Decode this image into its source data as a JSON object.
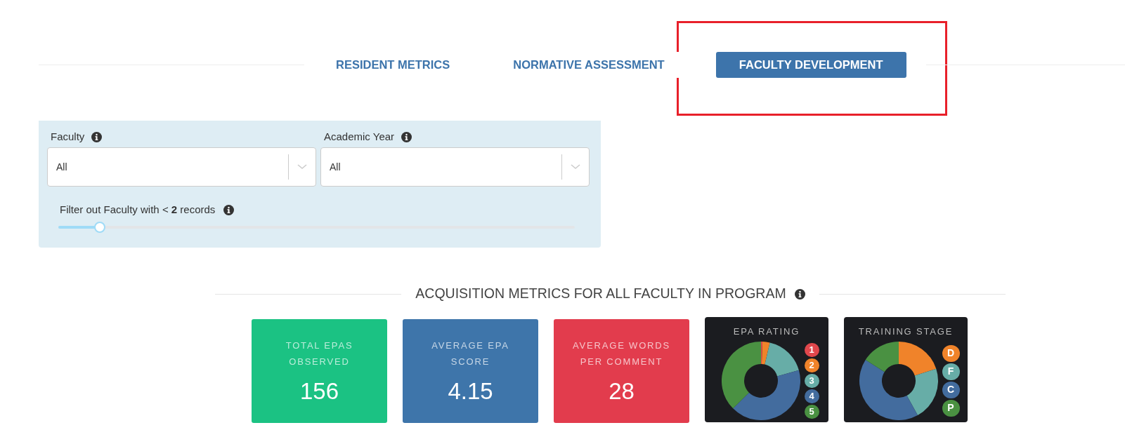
{
  "tabs": [
    {
      "label": "RESIDENT METRICS",
      "selected": false
    },
    {
      "label": "NORMATIVE ASSESSMENT",
      "selected": false
    },
    {
      "label": "FACULTY DEVELOPMENT",
      "selected": true
    }
  ],
  "filters": {
    "selects": [
      {
        "label": "Faculty",
        "value": "All"
      },
      {
        "label": "Academic Year",
        "value": "All"
      }
    ],
    "min_records": {
      "text": "Filter out Faculty with < **2** records",
      "level": 0.08
    }
  },
  "section_title": "ACQUISITION METRICS FOR ALL FACULTY IN PROGRAM",
  "stat_cards": [
    {
      "label": "TOTAL EPAS OBSERVED",
      "value": "156",
      "color": "#1bc283"
    },
    {
      "label": "AVERAGE EPA SCORE",
      "value": "4.15",
      "color": "#3e75aa"
    },
    {
      "label": "AVERAGE WORDS PER COMMENT",
      "value": "28",
      "color": "#e23c4d"
    }
  ],
  "donut_cards": [
    {
      "title": "EPA RATING",
      "legend": [
        {
          "label": "1",
          "color": "#e0474c"
        },
        {
          "label": "2",
          "color": "#f0832a"
        },
        {
          "label": "3",
          "color": "#67ada7"
        },
        {
          "label": "4",
          "color": "#436c9e"
        },
        {
          "label": "5",
          "color": "#4a9142"
        }
      ]
    },
    {
      "title": "TRAINING STAGE",
      "legend": [
        {
          "label": "D",
          "color": "#f0832a"
        },
        {
          "label": "F",
          "color": "#67ada7"
        },
        {
          "label": "C",
          "color": "#436c9e"
        },
        {
          "label": "P",
          "color": "#4a9142"
        }
      ]
    }
  ]
}
